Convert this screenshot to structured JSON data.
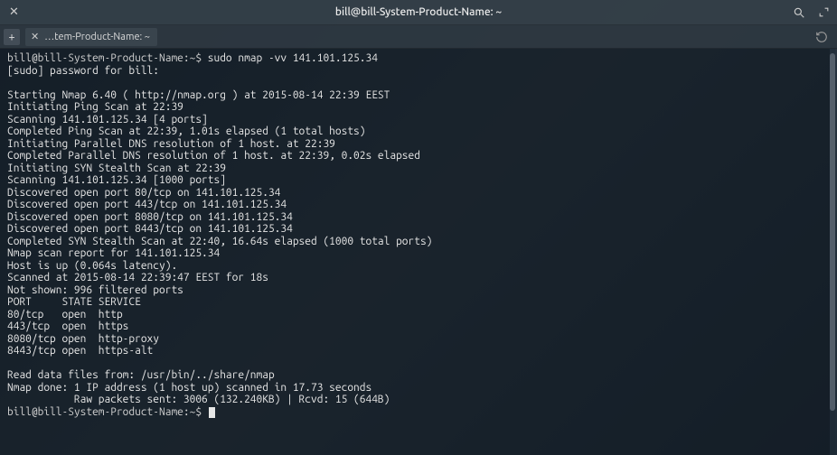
{
  "titlebar": {
    "close": "✕",
    "title": "bill@bill-System-Product-Name: ~"
  },
  "tabbar": {
    "add": "+",
    "tab_close": "✕",
    "tab_label": "…tem-Product-Name: ~"
  },
  "terminal": {
    "line1_prompt": "bill@bill-System-Product-Name:~$ ",
    "line1_cmd": "sudo nmap -vv 141.101.125.34",
    "line2": "[sudo] password for bill:",
    "line3": "",
    "line4": "Starting Nmap 6.40 ( http://nmap.org ) at 2015-08-14 22:39 EEST",
    "line5": "Initiating Ping Scan at 22:39",
    "line6": "Scanning 141.101.125.34 [4 ports]",
    "line7": "Completed Ping Scan at 22:39, 1.01s elapsed (1 total hosts)",
    "line8": "Initiating Parallel DNS resolution of 1 host. at 22:39",
    "line9": "Completed Parallel DNS resolution of 1 host. at 22:39, 0.02s elapsed",
    "line10": "Initiating SYN Stealth Scan at 22:39",
    "line11": "Scanning 141.101.125.34 [1000 ports]",
    "line12": "Discovered open port 80/tcp on 141.101.125.34",
    "line13": "Discovered open port 443/tcp on 141.101.125.34",
    "line14": "Discovered open port 8080/tcp on 141.101.125.34",
    "line15": "Discovered open port 8443/tcp on 141.101.125.34",
    "line16": "Completed SYN Stealth Scan at 22:40, 16.64s elapsed (1000 total ports)",
    "line17": "Nmap scan report for 141.101.125.34",
    "line18": "Host is up (0.064s latency).",
    "line19": "Scanned at 2015-08-14 22:39:47 EEST for 18s",
    "line20": "Not shown: 996 filtered ports",
    "line21": "PORT     STATE SERVICE",
    "line22": "80/tcp   open  http",
    "line23": "443/tcp  open  https",
    "line24": "8080/tcp open  http-proxy",
    "line25": "8443/tcp open  https-alt",
    "line26": "",
    "line27": "Read data files from: /usr/bin/../share/nmap",
    "line28": "Nmap done: 1 IP address (1 host up) scanned in 17.73 seconds",
    "line29": "           Raw packets sent: 3006 (132.240KB) | Rcvd: 15 (644B)",
    "line30_prompt": "bill@bill-System-Product-Name:~$ "
  }
}
